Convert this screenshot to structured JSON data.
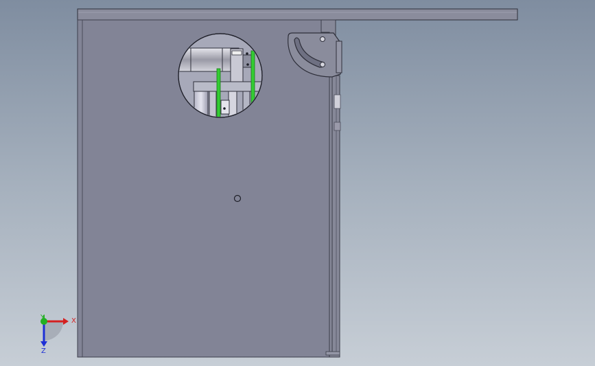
{
  "triad": {
    "x_label": "X",
    "y_label": "Y",
    "z_label": "Z",
    "x_color": "#d42020",
    "y_color": "#22b022",
    "z_color": "#1d2fd6"
  },
  "colors": {
    "panel": "#828496",
    "panel_stroke": "#3c3e4c",
    "green_chain": "#33cc33"
  }
}
